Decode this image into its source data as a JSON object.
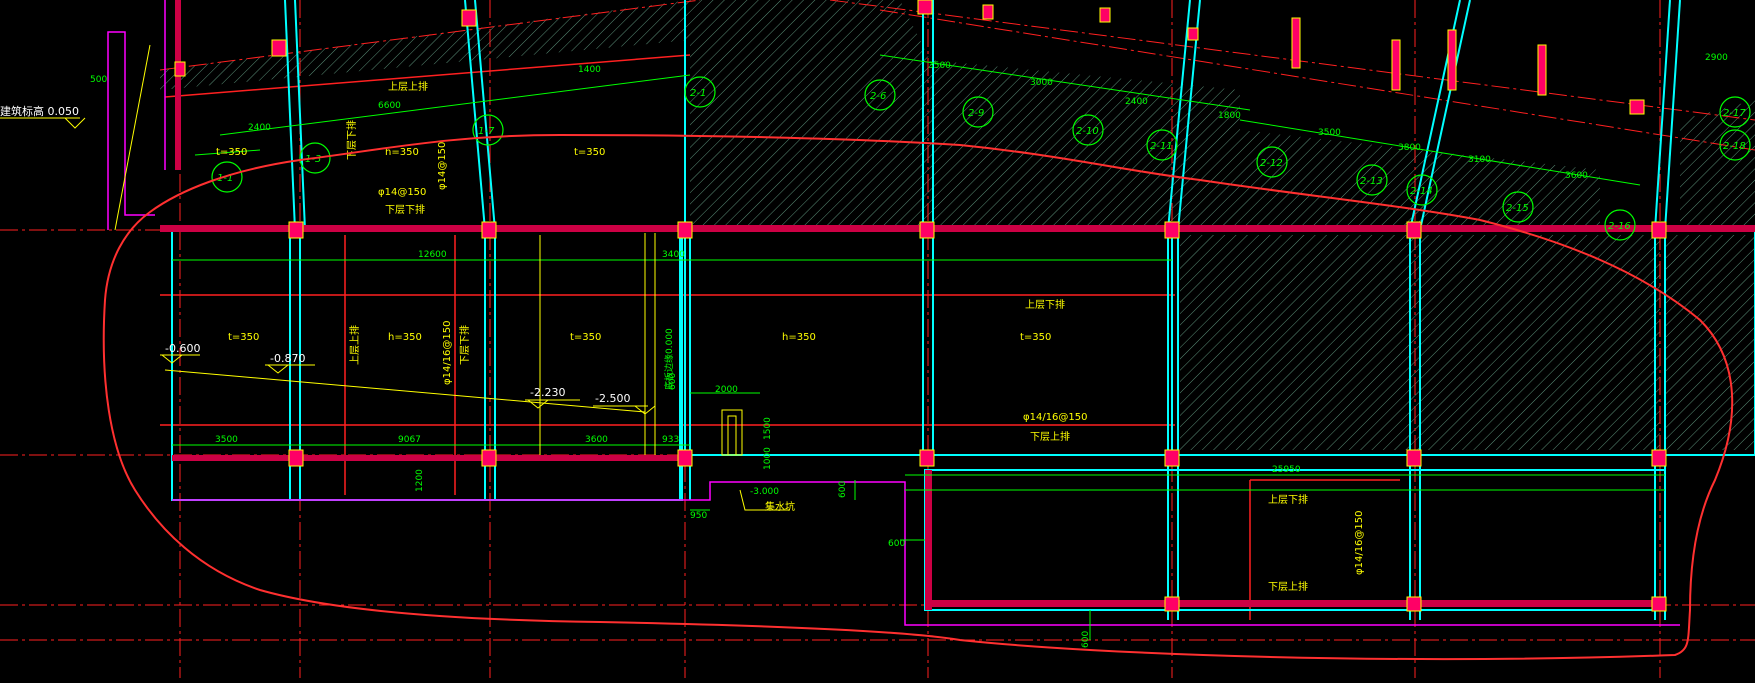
{
  "drawing": {
    "colors": {
      "background": "#000000",
      "wall": "#00ffff",
      "wall_inner": "#22cccc",
      "red_line": "#ff2020",
      "column": "#ff0066",
      "yellow": "#ffff00",
      "green": "#00ff00",
      "magenta": "#ff00ff",
      "white": "#ffffff",
      "hatch": "#6fae8f",
      "annotation_cloud": "#ff3030"
    },
    "title_label": "建筑标高 0.050",
    "top_dims": [
      "500",
      "2400",
      "6600",
      "1400",
      "3500",
      "3000",
      "2400",
      "1800",
      "3500",
      "3800",
      "3100",
      "3600",
      "2900"
    ],
    "axis_labels": [
      "1-1",
      "1-3",
      "1-7",
      "2-1",
      "2-6",
      "2-9",
      "2-10",
      "2-11",
      "2-12",
      "2-13",
      "2-14",
      "2-15",
      "2-16",
      "2-17",
      "2-18"
    ],
    "thickness_labels": [
      "t=350",
      "h=350",
      "t=350",
      "t=350",
      "h=350",
      "t=350",
      "h=350",
      "t=350"
    ],
    "rebar": {
      "top_upper": "上层上排",
      "top_phi": "φ14@150",
      "top_lower": "下层下排",
      "vertical_1": "φ14@150",
      "vertical_2": "下层下排",
      "mid_phi": "φ14/16@150",
      "mid_upper": "上层下排",
      "mid_lower": "下层上排",
      "left_mid_upper": "上层上排",
      "left_mid_lower": "下层下排",
      "bottom_upper": "上层下排",
      "bottom_lower": "下层上排",
      "bottom_phi": "φ14/16@150"
    },
    "elevations": [
      "-0.600",
      "-0.870",
      "-2.230",
      "-2.500",
      "-3.000"
    ],
    "pit_label": "集水坑",
    "pit_dims": [
      "2000",
      "1500",
      "1000",
      "600"
    ],
    "mid_dims": [
      "12600",
      "3400"
    ],
    "base_dims": [
      "3500",
      "9067",
      "3600",
      "933",
      "1200",
      "950",
      "600",
      "600",
      "600",
      "25950"
    ],
    "slope_label": "底板边缘0.000"
  }
}
